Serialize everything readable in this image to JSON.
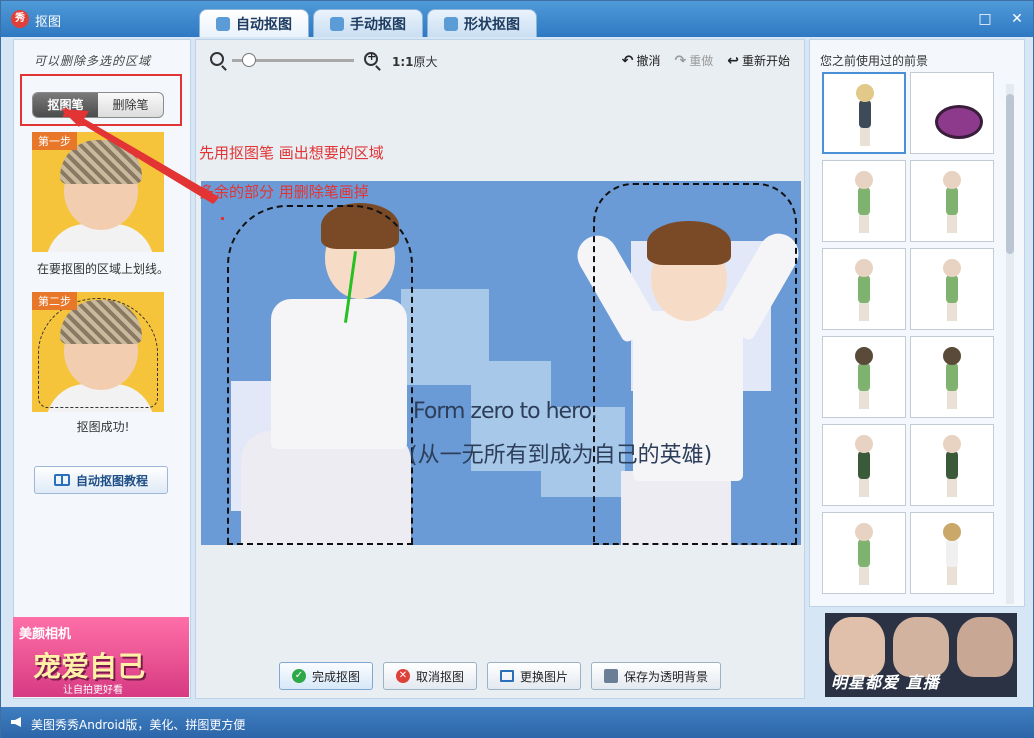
{
  "window": {
    "title": "抠图",
    "app_icon_text": "秀",
    "controls": [
      "restore-icon",
      "close-icon"
    ]
  },
  "tabs": [
    {
      "label": "自动抠图",
      "active": true
    },
    {
      "label": "手动抠图",
      "active": false
    },
    {
      "label": "形状抠图",
      "active": false
    }
  ],
  "left_panel": {
    "handwritten_note": "可以删除多选的区域",
    "pen_buttons": [
      {
        "label": "抠图笔",
        "active": true
      },
      {
        "label": "删除笔",
        "active": false
      }
    ],
    "step1": {
      "badge": "第一步",
      "caption": "在要抠图的区域上划线。"
    },
    "step2": {
      "badge": "第二步",
      "caption": "抠图成功!"
    },
    "tutorial_button": "自动抠图教程",
    "ad": {
      "brand": "美颜相机",
      "slogan": "宠爱自己",
      "sub": "让自拍更好看"
    }
  },
  "toolbar": {
    "original_size_bold": "1:1",
    "original_size_label": "原大",
    "undo": "撤消",
    "redo": "重做",
    "restart": "重新开始"
  },
  "annotations": {
    "line1": "先用抠图笔 画出想要的区域",
    "line2": "多余的部分 用删除笔画掉"
  },
  "canvas": {
    "text_line1": "Form zero to hero.",
    "text_line2": "(从一无所有到成为自己的英雄)"
  },
  "bottom_buttons": [
    {
      "label": "完成抠图",
      "icon": "check-icon"
    },
    {
      "label": "取消抠图",
      "icon": "cancel-icon"
    },
    {
      "label": "更换图片",
      "icon": "image-icon"
    },
    {
      "label": "保存为透明背景",
      "icon": "save-icon"
    }
  ],
  "right_panel": {
    "title": "您之前使用过的前景"
  },
  "right_ad": {
    "text": "明星都爱 直播"
  },
  "statusbar": {
    "text": "美图秀秀Android版，美化、拼图更方便"
  },
  "colors": {
    "accent_red": "#e23434",
    "title_blue": "#2f79c3",
    "canvas_bg": "#6b9bd6",
    "stroke_green": "#26c022"
  }
}
